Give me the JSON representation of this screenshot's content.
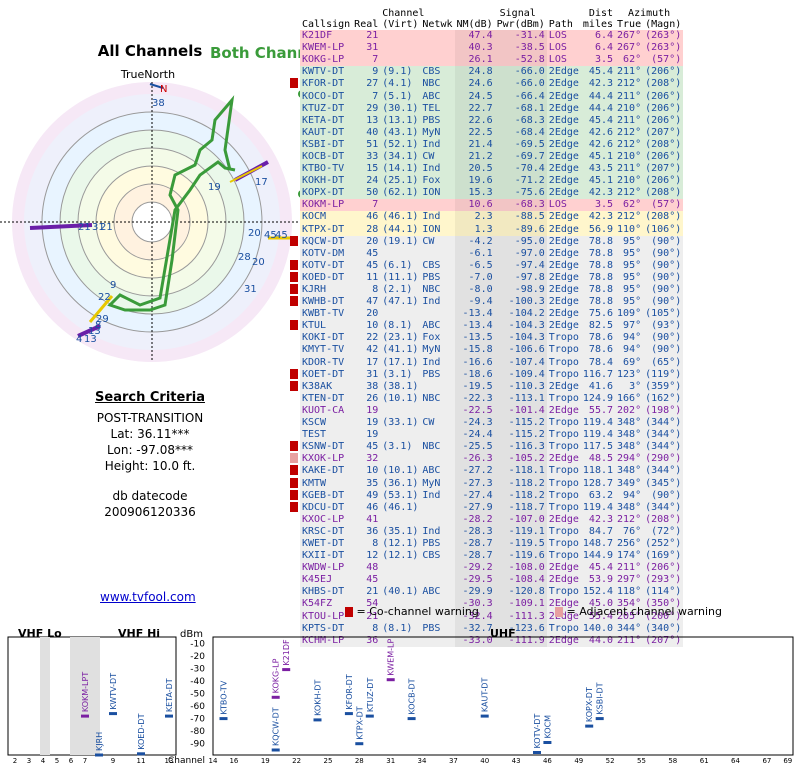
{
  "header": {
    "channel_group": "Channel",
    "signal_group": "Signal",
    "azimuth_group": "Azimuth",
    "dist_top": "Dist",
    "cols": [
      "Callsign",
      "Real",
      "(Virt)",
      "Netwk",
      "NM(dB)",
      "Pwr(dBm)",
      "Path",
      "miles",
      "True",
      "(Magn)"
    ]
  },
  "left": {
    "title": "All Channels",
    "annotation": "Both Channel 7",
    "truenorth": "TrueNorth",
    "n_label": "N"
  },
  "search": {
    "heading": "Search Criteria",
    "mode": "POST-TRANSITION",
    "lat": "Lat: 36.11***",
    "lon": "Lon: -97.08***",
    "height": "Height: 10.0 ft.",
    "db_label": "db datecode",
    "db_code": "200906120336"
  },
  "site_link": "www.tvfool.com",
  "legend": {
    "co": "= Co-channel warning",
    "adj": "= Adjacent channel warning"
  },
  "rows": [
    {
      "cs": "K21DF",
      "real": "21",
      "virt": "",
      "net": "",
      "nm": "47.4",
      "pwr": "-31.4",
      "path": "LOS",
      "dist": "6.4",
      "true": "267°",
      "magn": "(263°)",
      "color": "#7b1fa2",
      "bg": "#ffd0d0",
      "flag": ""
    },
    {
      "cs": "KWEM-LP",
      "real": "31",
      "virt": "",
      "net": "",
      "nm": "40.3",
      "pwr": "-38.5",
      "path": "LOS",
      "dist": "6.4",
      "true": "267°",
      "magn": "(263°)",
      "color": "#7b1fa2",
      "bg": "#ffd0d0",
      "flag": ""
    },
    {
      "cs": "KOKG-LP",
      "real": "7",
      "virt": "",
      "net": "",
      "nm": "26.1",
      "pwr": "-52.8",
      "path": "LOS",
      "dist": "3.5",
      "true": "62°",
      "magn": "(57°)",
      "color": "#7b1fa2",
      "bg": "#ffd0d0",
      "flag": ""
    },
    {
      "cs": "KWTV-DT",
      "real": "9",
      "virt": "(9.1)",
      "net": "CBS",
      "nm": "24.8",
      "pwr": "-66.0",
      "path": "2Edge",
      "dist": "45.4",
      "true": "211°",
      "magn": "(206°)",
      "color": "#1a4fa0",
      "bg": "#d8ecd8",
      "flag": ""
    },
    {
      "cs": "KFOR-DT",
      "real": "27",
      "virt": "(4.1)",
      "net": "NBC",
      "nm": "24.6",
      "pwr": "-66.0",
      "path": "2Edge",
      "dist": "42.3",
      "true": "212°",
      "magn": "(208°)",
      "color": "#1a4fa0",
      "bg": "#d8ecd8",
      "flag": "co"
    },
    {
      "cs": "KOCO-DT",
      "real": "7",
      "virt": "(5.1)",
      "net": "ABC",
      "nm": "24.5",
      "pwr": "-66.4",
      "path": "2Edge",
      "dist": "44.4",
      "true": "211°",
      "magn": "(206°)",
      "color": "#1a4fa0",
      "bg": "#d8ecd8",
      "flag": ""
    },
    {
      "cs": "KTUZ-DT",
      "real": "29",
      "virt": "(30.1)",
      "net": "TEL",
      "nm": "22.7",
      "pwr": "-68.1",
      "path": "2Edge",
      "dist": "44.4",
      "true": "210°",
      "magn": "(206°)",
      "color": "#1a4fa0",
      "bg": "#d8ecd8",
      "flag": ""
    },
    {
      "cs": "KETA-DT",
      "real": "13",
      "virt": "(13.1)",
      "net": "PBS",
      "nm": "22.6",
      "pwr": "-68.3",
      "path": "2Edge",
      "dist": "45.4",
      "true": "211°",
      "magn": "(206°)",
      "color": "#1a4fa0",
      "bg": "#d8ecd8",
      "flag": ""
    },
    {
      "cs": "KAUT-DT",
      "real": "40",
      "virt": "(43.1)",
      "net": "MyN",
      "nm": "22.5",
      "pwr": "-68.4",
      "path": "2Edge",
      "dist": "42.6",
      "true": "212°",
      "magn": "(207°)",
      "color": "#1a4fa0",
      "bg": "#d8ecd8",
      "flag": ""
    },
    {
      "cs": "KSBI-DT",
      "real": "51",
      "virt": "(52.1)",
      "net": "Ind",
      "nm": "21.4",
      "pwr": "-69.5",
      "path": "2Edge",
      "dist": "42.6",
      "true": "212°",
      "magn": "(208°)",
      "color": "#1a4fa0",
      "bg": "#d8ecd8",
      "flag": ""
    },
    {
      "cs": "KOCB-DT",
      "real": "33",
      "virt": "(34.1)",
      "net": "CW",
      "nm": "21.2",
      "pwr": "-69.7",
      "path": "2Edge",
      "dist": "45.1",
      "true": "210°",
      "magn": "(206°)",
      "color": "#1a4fa0",
      "bg": "#d8ecd8",
      "flag": ""
    },
    {
      "cs": "KTBO-TV",
      "real": "15",
      "virt": "(14.1)",
      "net": "Ind",
      "nm": "20.5",
      "pwr": "-70.4",
      "path": "2Edge",
      "dist": "43.5",
      "true": "211°",
      "magn": "(207°)",
      "color": "#1a4fa0",
      "bg": "#d8ecd8",
      "flag": ""
    },
    {
      "cs": "KOKH-DT",
      "real": "24",
      "virt": "(25.1)",
      "net": "Fox",
      "nm": "19.6",
      "pwr": "-71.2",
      "path": "2Edge",
      "dist": "45.1",
      "true": "210°",
      "magn": "(206°)",
      "color": "#1a4fa0",
      "bg": "#d8ecd8",
      "flag": ""
    },
    {
      "cs": "KOPX-DT",
      "real": "50",
      "virt": "(62.1)",
      "net": "ION",
      "nm": "15.3",
      "pwr": "-75.6",
      "path": "2Edge",
      "dist": "42.3",
      "true": "212°",
      "magn": "(208°)",
      "color": "#1a4fa0",
      "bg": "#d8ecd8",
      "flag": ""
    },
    {
      "cs": "KOKM-LP",
      "real": "7",
      "virt": "",
      "net": "",
      "nm": "10.6",
      "pwr": "-68.3",
      "path": "LOS",
      "dist": "3.5",
      "true": "62°",
      "magn": "(57°)",
      "color": "#7b1fa2",
      "bg": "#ffd0d0",
      "flag": ""
    },
    {
      "cs": "KOCM",
      "real": "46",
      "virt": "(46.1)",
      "net": "Ind",
      "nm": "2.3",
      "pwr": "-88.5",
      "path": "2Edge",
      "dist": "42.3",
      "true": "212°",
      "magn": "(208°)",
      "color": "#1a4fa0",
      "bg": "#fff6cc",
      "flag": ""
    },
    {
      "cs": "KTPX-DT",
      "real": "28",
      "virt": "(44.1)",
      "net": "ION",
      "nm": "1.3",
      "pwr": "-89.6",
      "path": "2Edge",
      "dist": "56.9",
      "true": "110°",
      "magn": "(106°)",
      "color": "#1a4fa0",
      "bg": "#fff6cc",
      "flag": ""
    },
    {
      "cs": "KQCW-DT",
      "real": "20",
      "virt": "(19.1)",
      "net": "CW",
      "nm": "-4.2",
      "pwr": "-95.0",
      "path": "2Edge",
      "dist": "78.8",
      "true": "95°",
      "magn": "(90°)",
      "color": "#1a4fa0",
      "bg": "#eeeeee",
      "flag": "co"
    },
    {
      "cs": "KOTV-DM",
      "real": "45",
      "virt": "",
      "net": "",
      "nm": "-6.1",
      "pwr": "-97.0",
      "path": "2Edge",
      "dist": "78.8",
      "true": "95°",
      "magn": "(90°)",
      "color": "#1a4fa0",
      "bg": "#eeeeee",
      "flag": ""
    },
    {
      "cs": "KOTV-DT",
      "real": "45",
      "virt": "(6.1)",
      "net": "CBS",
      "nm": "-6.5",
      "pwr": "-97.4",
      "path": "2Edge",
      "dist": "78.8",
      "true": "95°",
      "magn": "(90°)",
      "color": "#1a4fa0",
      "bg": "#eeeeee",
      "flag": "co"
    },
    {
      "cs": "KOED-DT",
      "real": "11",
      "virt": "(11.1)",
      "net": "PBS",
      "nm": "-7.0",
      "pwr": "-97.8",
      "path": "2Edge",
      "dist": "78.8",
      "true": "95°",
      "magn": "(90°)",
      "color": "#1a4fa0",
      "bg": "#eeeeee",
      "flag": "co"
    },
    {
      "cs": "KJRH",
      "real": "8",
      "virt": "(2.1)",
      "net": "NBC",
      "nm": "-8.0",
      "pwr": "-98.9",
      "path": "2Edge",
      "dist": "78.8",
      "true": "95°",
      "magn": "(90°)",
      "color": "#1a4fa0",
      "bg": "#eeeeee",
      "flag": "co"
    },
    {
      "cs": "KWHB-DT",
      "real": "47",
      "virt": "(47.1)",
      "net": "Ind",
      "nm": "-9.4",
      "pwr": "-100.3",
      "path": "2Edge",
      "dist": "78.8",
      "true": "95°",
      "magn": "(90°)",
      "color": "#1a4fa0",
      "bg": "#eeeeee",
      "flag": "co"
    },
    {
      "cs": "KWBT-TV",
      "real": "20",
      "virt": "",
      "net": "",
      "nm": "-13.4",
      "pwr": "-104.2",
      "path": "2Edge",
      "dist": "75.6",
      "true": "109°",
      "magn": "(105°)",
      "color": "#1a4fa0",
      "bg": "#eeeeee",
      "flag": ""
    },
    {
      "cs": "KTUL",
      "real": "10",
      "virt": "(8.1)",
      "net": "ABC",
      "nm": "-13.4",
      "pwr": "-104.3",
      "path": "2Edge",
      "dist": "82.5",
      "true": "97°",
      "magn": "(93°)",
      "color": "#1a4fa0",
      "bg": "#eeeeee",
      "flag": "co"
    },
    {
      "cs": "KOKI-DT",
      "real": "22",
      "virt": "(23.1)",
      "net": "Fox",
      "nm": "-13.5",
      "pwr": "-104.3",
      "path": "Tropo",
      "dist": "78.6",
      "true": "94°",
      "magn": "(90°)",
      "color": "#1a4fa0",
      "bg": "#eeeeee",
      "flag": ""
    },
    {
      "cs": "KMYT-TV",
      "real": "42",
      "virt": "(41.1)",
      "net": "MyN",
      "nm": "-15.8",
      "pwr": "-106.6",
      "path": "Tropo",
      "dist": "78.6",
      "true": "94°",
      "magn": "(90°)",
      "color": "#1a4fa0",
      "bg": "#eeeeee",
      "flag": ""
    },
    {
      "cs": "KDOR-TV",
      "real": "17",
      "virt": "(17.1)",
      "net": "Ind",
      "nm": "-16.6",
      "pwr": "-107.4",
      "path": "Tropo",
      "dist": "78.4",
      "true": "69°",
      "magn": "(65°)",
      "color": "#1a4fa0",
      "bg": "#eeeeee",
      "flag": ""
    },
    {
      "cs": "KOET-DT",
      "real": "31",
      "virt": "(3.1)",
      "net": "PBS",
      "nm": "-18.6",
      "pwr": "-109.4",
      "path": "Tropo",
      "dist": "116.7",
      "true": "123°",
      "magn": "(119°)",
      "color": "#1a4fa0",
      "bg": "#eeeeee",
      "flag": "co"
    },
    {
      "cs": "K38AK",
      "real": "38",
      "virt": "(38.1)",
      "net": "",
      "nm": "-19.5",
      "pwr": "-110.3",
      "path": "2Edge",
      "dist": "41.6",
      "true": "3°",
      "magn": "(359°)",
      "color": "#1a4fa0",
      "bg": "#eeeeee",
      "flag": "co"
    },
    {
      "cs": "KTEN-DT",
      "real": "26",
      "virt": "(10.1)",
      "net": "NBC",
      "nm": "-22.3",
      "pwr": "-113.1",
      "path": "Tropo",
      "dist": "124.9",
      "true": "166°",
      "magn": "(162°)",
      "color": "#1a4fa0",
      "bg": "#eeeeee",
      "flag": ""
    },
    {
      "cs": "KUOT-CA",
      "real": "19",
      "virt": "",
      "net": "",
      "nm": "-22.5",
      "pwr": "-101.4",
      "path": "2Edge",
      "dist": "55.7",
      "true": "202°",
      "magn": "(198°)",
      "color": "#7b1fa2",
      "bg": "#eeeeee",
      "flag": ""
    },
    {
      "cs": "KSCW",
      "real": "19",
      "virt": "(33.1)",
      "net": "CW",
      "nm": "-24.3",
      "pwr": "-115.2",
      "path": "Tropo",
      "dist": "119.4",
      "true": "348°",
      "magn": "(344°)",
      "color": "#1a4fa0",
      "bg": "#eeeeee",
      "flag": ""
    },
    {
      "cs": "TEST",
      "real": "19",
      "virt": "",
      "net": "",
      "nm": "-24.4",
      "pwr": "-115.2",
      "path": "Tropo",
      "dist": "119.4",
      "true": "348°",
      "magn": "(344°)",
      "color": "#1a4fa0",
      "bg": "#eeeeee",
      "flag": ""
    },
    {
      "cs": "KSNW-DT",
      "real": "45",
      "virt": "(3.1)",
      "net": "NBC",
      "nm": "-25.5",
      "pwr": "-116.3",
      "path": "Tropo",
      "dist": "117.5",
      "true": "348°",
      "magn": "(344°)",
      "color": "#1a4fa0",
      "bg": "#eeeeee",
      "flag": "co"
    },
    {
      "cs": "KXOK-LP",
      "real": "32",
      "virt": "",
      "net": "",
      "nm": "-26.3",
      "pwr": "-105.2",
      "path": "2Edge",
      "dist": "48.5",
      "true": "294°",
      "magn": "(290°)",
      "color": "#7b1fa2",
      "bg": "#eeeeee",
      "flag": "adj"
    },
    {
      "cs": "KAKE-DT",
      "real": "10",
      "virt": "(10.1)",
      "net": "ABC",
      "nm": "-27.2",
      "pwr": "-118.1",
      "path": "Tropo",
      "dist": "118.1",
      "true": "348°",
      "magn": "(344°)",
      "color": "#1a4fa0",
      "bg": "#eeeeee",
      "flag": "co"
    },
    {
      "cs": "KMTW",
      "real": "35",
      "virt": "(36.1)",
      "net": "MyN",
      "nm": "-27.3",
      "pwr": "-118.2",
      "path": "Tropo",
      "dist": "128.7",
      "true": "349°",
      "magn": "(345°)",
      "color": "#1a4fa0",
      "bg": "#eeeeee",
      "flag": "co"
    },
    {
      "cs": "KGEB-DT",
      "real": "49",
      "virt": "(53.1)",
      "net": "Ind",
      "nm": "-27.4",
      "pwr": "-118.2",
      "path": "Tropo",
      "dist": "63.2",
      "true": "94°",
      "magn": "(90°)",
      "color": "#1a4fa0",
      "bg": "#eeeeee",
      "flag": "co"
    },
    {
      "cs": "KDCU-DT",
      "real": "46",
      "virt": "(46.1)",
      "net": "",
      "nm": "-27.9",
      "pwr": "-118.7",
      "path": "Tropo",
      "dist": "119.4",
      "true": "348°",
      "magn": "(344°)",
      "color": "#1a4fa0",
      "bg": "#eeeeee",
      "flag": "co"
    },
    {
      "cs": "KXOC-LP",
      "real": "41",
      "virt": "",
      "net": "",
      "nm": "-28.2",
      "pwr": "-107.0",
      "path": "2Edge",
      "dist": "42.3",
      "true": "212°",
      "magn": "(208°)",
      "color": "#7b1fa2",
      "bg": "#eeeeee",
      "flag": ""
    },
    {
      "cs": "KRSC-DT",
      "real": "36",
      "virt": "(35.1)",
      "net": "Ind",
      "nm": "-28.3",
      "pwr": "-119.1",
      "path": "Tropo",
      "dist": "84.7",
      "true": "76°",
      "magn": "(72°)",
      "color": "#1a4fa0",
      "bg": "#eeeeee",
      "flag": ""
    },
    {
      "cs": "KWET-DT",
      "real": "8",
      "virt": "(12.1)",
      "net": "PBS",
      "nm": "-28.7",
      "pwr": "-119.5",
      "path": "Tropo",
      "dist": "148.7",
      "true": "256°",
      "magn": "(252°)",
      "color": "#1a4fa0",
      "bg": "#eeeeee",
      "flag": ""
    },
    {
      "cs": "KXII-DT",
      "real": "12",
      "virt": "(12.1)",
      "net": "CBS",
      "nm": "-28.7",
      "pwr": "-119.6",
      "path": "Tropo",
      "dist": "144.9",
      "true": "174°",
      "magn": "(169°)",
      "color": "#1a4fa0",
      "bg": "#eeeeee",
      "flag": ""
    },
    {
      "cs": "KWDW-LP",
      "real": "48",
      "virt": "",
      "net": "",
      "nm": "-29.2",
      "pwr": "-108.0",
      "path": "2Edge",
      "dist": "45.4",
      "true": "211°",
      "magn": "(206°)",
      "color": "#7b1fa2",
      "bg": "#eeeeee",
      "flag": ""
    },
    {
      "cs": "K45EJ",
      "real": "45",
      "virt": "",
      "net": "",
      "nm": "-29.5",
      "pwr": "-108.4",
      "path": "2Edge",
      "dist": "53.9",
      "true": "297°",
      "magn": "(293°)",
      "color": "#7b1fa2",
      "bg": "#eeeeee",
      "flag": ""
    },
    {
      "cs": "KHBS-DT",
      "real": "21",
      "virt": "(40.1)",
      "net": "ABC",
      "nm": "-29.9",
      "pwr": "-120.8",
      "path": "Tropo",
      "dist": "152.4",
      "true": "118°",
      "magn": "(114°)",
      "color": "#1a4fa0",
      "bg": "#eeeeee",
      "flag": ""
    },
    {
      "cs": "K54FZ",
      "real": "54",
      "virt": "",
      "net": "",
      "nm": "-30.3",
      "pwr": "-109.1",
      "path": "2Edge",
      "dist": "45.0",
      "true": "354°",
      "magn": "(350°)",
      "color": "#7b1fa2",
      "bg": "#eeeeee",
      "flag": ""
    },
    {
      "cs": "KTOU-LP",
      "real": "21",
      "virt": "",
      "net": "",
      "nm": "-32.4",
      "pwr": "-111.3",
      "path": "2Edge",
      "dist": "55.4",
      "true": "205°",
      "magn": "(200°)",
      "color": "#7b1fa2",
      "bg": "#eeeeee",
      "flag": ""
    },
    {
      "cs": "KPTS-DT",
      "real": "8",
      "virt": "(8.1)",
      "net": "PBS",
      "nm": "-32.7",
      "pwr": "-123.6",
      "path": "Tropo",
      "dist": "140.0",
      "true": "344°",
      "magn": "(340°)",
      "color": "#1a4fa0",
      "bg": "#eeeeee",
      "flag": ""
    },
    {
      "cs": "KCHM-LP",
      "real": "36",
      "virt": "",
      "net": "",
      "nm": "-33.0",
      "pwr": "-111.9",
      "path": "2Edge",
      "dist": "44.0",
      "true": "211°",
      "magn": "(207°)",
      "color": "#7b1fa2",
      "bg": "#eeeeee",
      "flag": ""
    }
  ],
  "polar": {
    "labels": [
      "38",
      "21",
      "31",
      "21",
      "19",
      "17",
      "9",
      "22",
      "29",
      "20",
      "45",
      "45",
      "28",
      "20",
      "31",
      "4",
      "13",
      "13",
      "8"
    ]
  },
  "chart": {
    "vhf_lo": "VHF Lo",
    "vhf_hi": "VHF Hi",
    "uhf": "UHF",
    "dbm": "dBm",
    "channel_label": "Channel",
    "y_ticks": [
      "-10",
      "-20",
      "-30",
      "-40",
      "-50",
      "-60",
      "-70",
      "-80",
      "-90"
    ],
    "vhf_lo_ticks": [
      "2",
      "3",
      "4",
      "5",
      "6"
    ],
    "vhf_hi_ticks": [
      "7",
      "9",
      "11",
      "13"
    ],
    "uhf_ticks": [
      "14",
      "16",
      "19",
      "22",
      "25",
      "28",
      "31",
      "34",
      "37",
      "40",
      "43",
      "46",
      "49",
      "52",
      "55",
      "58",
      "61",
      "64",
      "67",
      "69"
    ],
    "bars": [
      {
        "label": "KOKM-LPT",
        "ch": 7,
        "dbm": -68,
        "color": "#7b1fa2"
      },
      {
        "label": "KWTV-DT",
        "ch": 9,
        "dbm": -66,
        "color": "#1a4fa0"
      },
      {
        "label": "KETA-DT",
        "ch": 13,
        "dbm": -68,
        "color": "#1a4fa0"
      },
      {
        "label": "KJRH",
        "ch": 8,
        "dbm": -99,
        "color": "#1a4fa0"
      },
      {
        "label": "KOED-DT",
        "ch": 11,
        "dbm": -98,
        "color": "#1a4fa0"
      },
      {
        "label": "KTBO-TV",
        "ch": 15,
        "dbm": -70,
        "color": "#1a4fa0"
      },
      {
        "label": "KOKG-LP",
        "ch": 20,
        "dbm": -53,
        "color": "#7b1fa2"
      },
      {
        "label": "K21DF",
        "ch": 21,
        "dbm": -31,
        "color": "#7b1fa2"
      },
      {
        "label": "KQCW-DT",
        "ch": 20,
        "dbm": -95,
        "color": "#1a4fa0"
      },
      {
        "label": "KOKH-DT",
        "ch": 24,
        "dbm": -71,
        "color": "#1a4fa0"
      },
      {
        "label": "KFOR-DT",
        "ch": 27,
        "dbm": -66,
        "color": "#1a4fa0"
      },
      {
        "label": "KTUZ-DT",
        "ch": 29,
        "dbm": -68,
        "color": "#1a4fa0"
      },
      {
        "label": "KTPX-DT",
        "ch": 28,
        "dbm": -90,
        "color": "#1a4fa0"
      },
      {
        "label": "KWEM-LP",
        "ch": 31,
        "dbm": -39,
        "color": "#7b1fa2"
      },
      {
        "label": "KOCB-DT",
        "ch": 33,
        "dbm": -70,
        "color": "#1a4fa0"
      },
      {
        "label": "KAUT-DT",
        "ch": 40,
        "dbm": -68,
        "color": "#1a4fa0"
      },
      {
        "label": "KOTV-DT",
        "ch": 45,
        "dbm": -97,
        "color": "#1a4fa0"
      },
      {
        "label": "KOCM",
        "ch": 46,
        "dbm": -89,
        "color": "#1a4fa0"
      },
      {
        "label": "KOPX-DT",
        "ch": 50,
        "dbm": -76,
        "color": "#1a4fa0"
      },
      {
        "label": "KSBI-DT",
        "ch": 51,
        "dbm": -70,
        "color": "#1a4fa0"
      }
    ]
  }
}
